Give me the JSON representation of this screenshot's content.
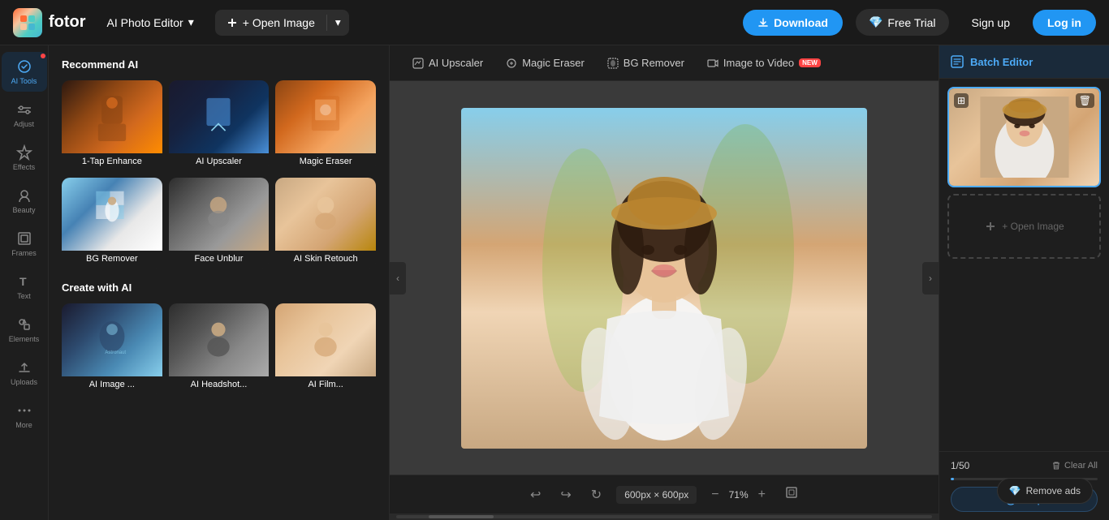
{
  "header": {
    "logo_text": "fotor",
    "app_title": "AI Photo Editor",
    "app_title_chevron": "▾",
    "open_image_label": "+ Open Image",
    "open_image_more": "▾",
    "download_label": "Download",
    "free_trial_label": "Free Trial",
    "signup_label": "Sign up",
    "login_label": "Log in"
  },
  "sidebar": {
    "items": [
      {
        "id": "ai-tools",
        "label": "AI Tools",
        "active": true
      },
      {
        "id": "adjust",
        "label": "Adjust",
        "active": false
      },
      {
        "id": "effects",
        "label": "Effects",
        "active": false
      },
      {
        "id": "beauty",
        "label": "Beauty",
        "active": false
      },
      {
        "id": "frames",
        "label": "Frames",
        "active": false
      },
      {
        "id": "text",
        "label": "Text",
        "active": false
      },
      {
        "id": "elements",
        "label": "Elements",
        "active": false
      },
      {
        "id": "uploads",
        "label": "Uploads",
        "active": false
      },
      {
        "id": "more",
        "label": "More",
        "active": false
      }
    ]
  },
  "panel": {
    "recommend_ai_title": "Recommend AI",
    "recommend_ai_items": [
      {
        "id": "1tap",
        "label": "1-Tap Enhance",
        "class": "card-1tap"
      },
      {
        "id": "upscaler",
        "label": "AI Upscaler",
        "class": "card-upscaler"
      },
      {
        "id": "eraser",
        "label": "Magic Eraser",
        "class": "card-eraser"
      },
      {
        "id": "bgremove",
        "label": "BG Remover",
        "class": "card-bgremove"
      },
      {
        "id": "faceunblur",
        "label": "Face Unblur",
        "class": "card-faceunblur"
      },
      {
        "id": "skinretouch",
        "label": "AI Skin Retouch",
        "class": "card-skinretouch"
      }
    ],
    "create_ai_title": "Create with AI",
    "create_ai_items": [
      {
        "id": "ai1",
        "label": "AI Image ...",
        "class": "card-ai1"
      },
      {
        "id": "ai2",
        "label": "AI Headshot...",
        "class": "card-ai2"
      },
      {
        "id": "ai3",
        "label": "AI Film...",
        "class": "card-ai3"
      }
    ]
  },
  "canvas": {
    "toolbar": [
      {
        "id": "ai-upscaler",
        "label": "AI Upscaler",
        "active": false,
        "new": false
      },
      {
        "id": "magic-eraser",
        "label": "Magic Eraser",
        "active": false,
        "new": false
      },
      {
        "id": "bg-remover",
        "label": "BG Remover",
        "active": false,
        "new": false
      },
      {
        "id": "image-to-video",
        "label": "Image to Video",
        "active": false,
        "new": true
      }
    ],
    "size_label": "600px × 600px",
    "zoom_label": "71%",
    "undo_icon": "↩",
    "redo_icon": "↪",
    "refresh_icon": "↻"
  },
  "right_panel": {
    "batch_editor_label": "Batch Editor",
    "batch_count": "1/50",
    "clear_all_label": "Clear All",
    "help_label": "Help",
    "open_image_label": "+ Open Image",
    "progress_percent": 2
  },
  "remove_ads": {
    "label": "Remove ads"
  }
}
